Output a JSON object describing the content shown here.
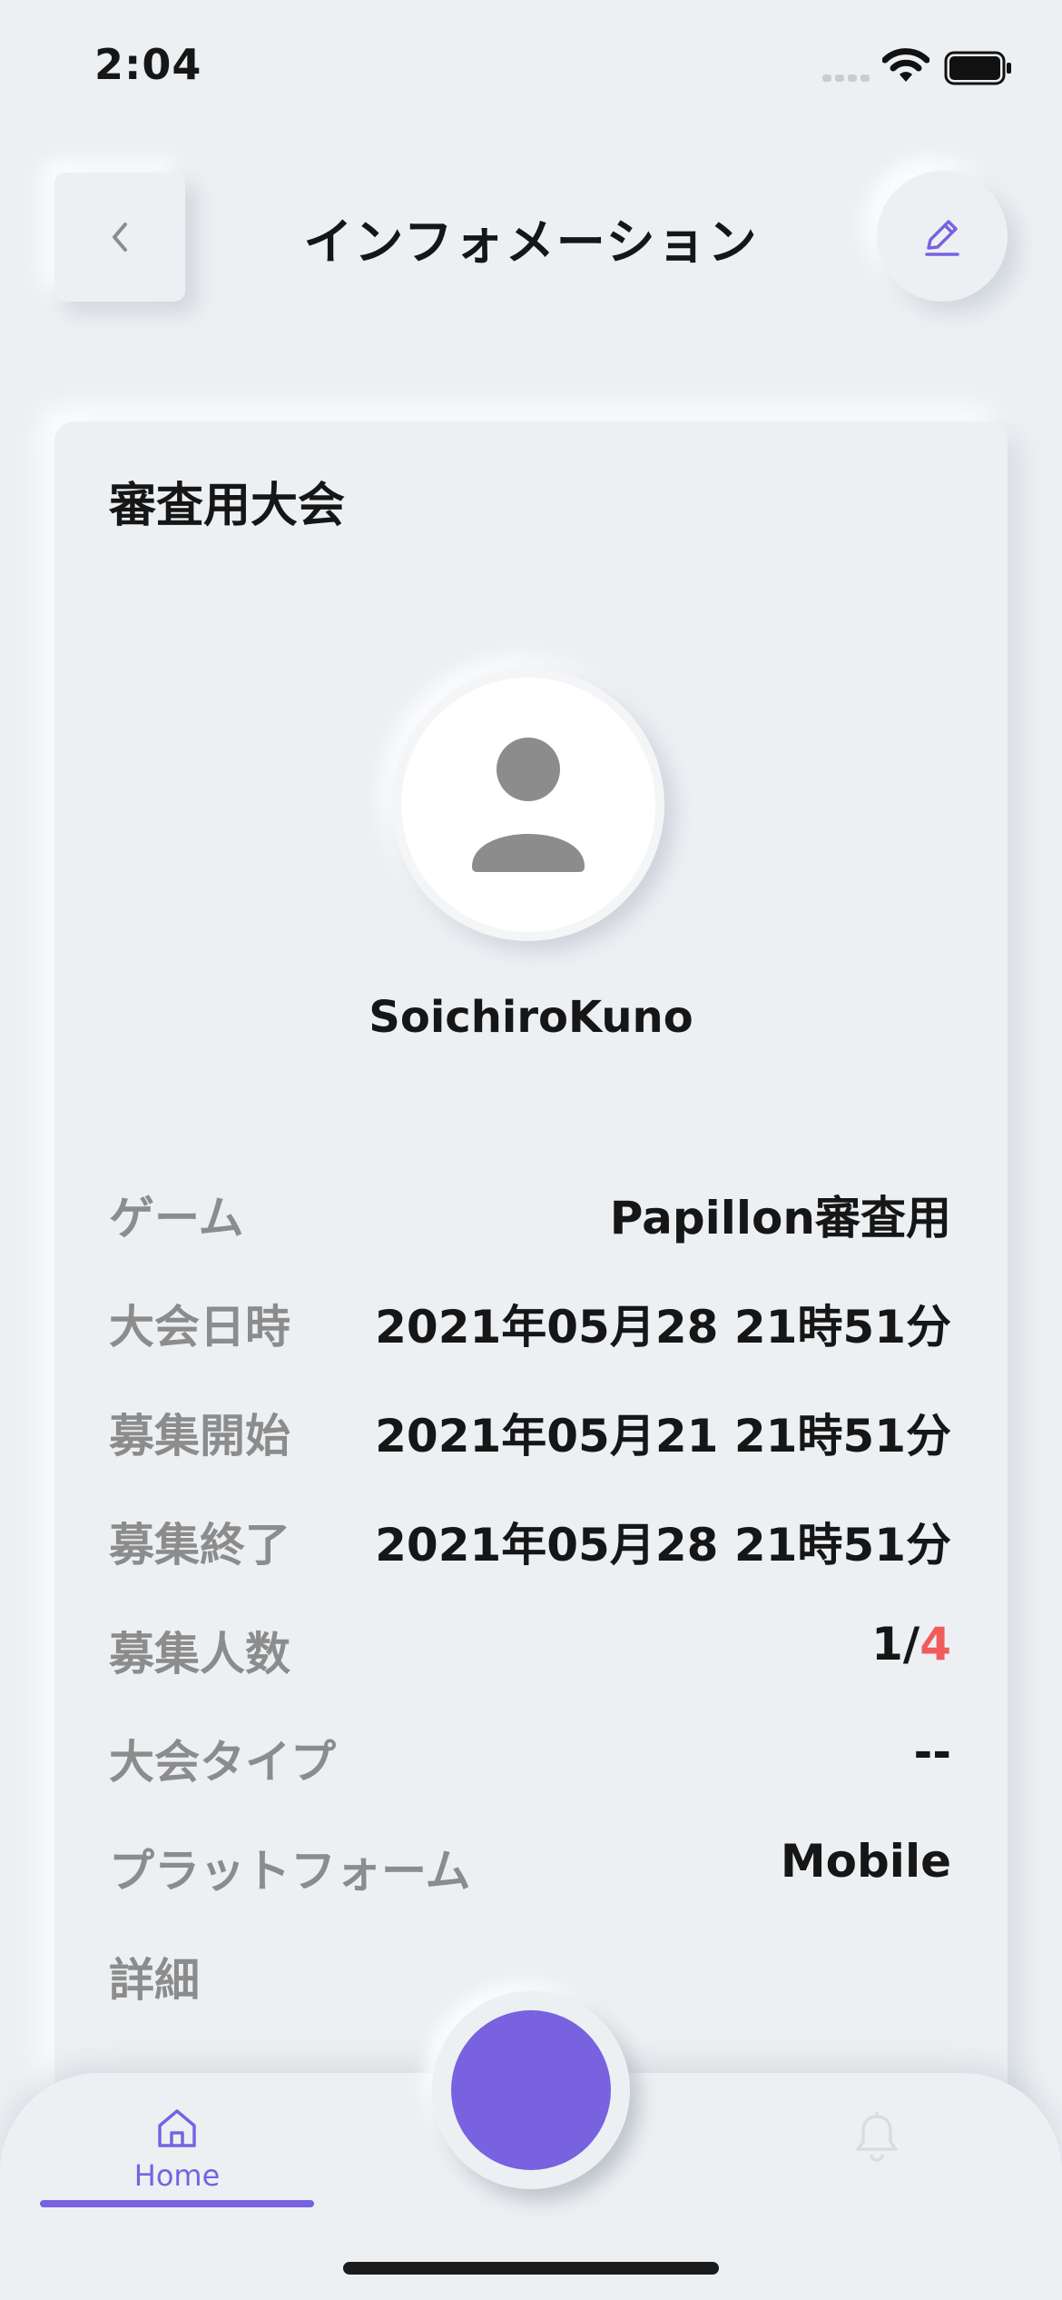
{
  "status_bar": {
    "time": "2:04"
  },
  "header": {
    "title": "インフォメーション"
  },
  "card": {
    "title": "審査用大会",
    "user_name": "SoichiroKuno",
    "rows": [
      {
        "label": "ゲーム",
        "value": "Papillon審査用"
      },
      {
        "label": "大会日時",
        "value": "2021年05月28 21時51分"
      },
      {
        "label": "募集開始",
        "value": "2021年05月21 21時51分"
      },
      {
        "label": "募集終了",
        "value": "2021年05月28 21時51分"
      },
      {
        "label": "募集人数",
        "value_current": "1/",
        "value_max": "4"
      },
      {
        "label": "大会タイプ",
        "value": "--"
      },
      {
        "label": "プラットフォーム",
        "value": "Mobile"
      },
      {
        "label": "詳細"
      }
    ]
  },
  "tab_bar": {
    "home_label": "Home"
  },
  "colors": {
    "accent": "#7862e0",
    "highlight": "#f25b5b",
    "background": "#edf0f3"
  },
  "icons": [
    "back-chevron-icon",
    "edit-pencil-icon",
    "user-placeholder-icon",
    "home-icon",
    "bell-icon",
    "wifi-icon",
    "battery-icon",
    "signal-icon"
  ]
}
